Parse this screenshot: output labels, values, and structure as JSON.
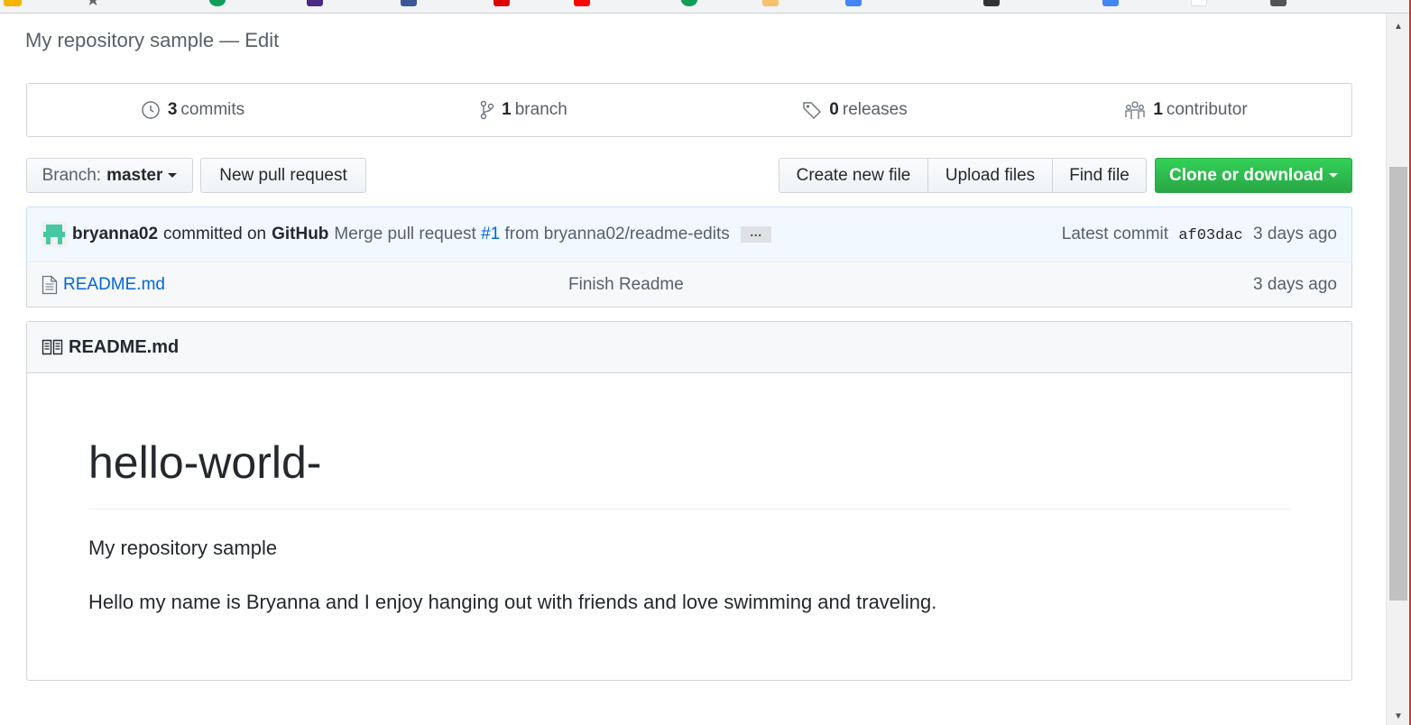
{
  "colors": {
    "link": "#0366d6",
    "clone_green": "#28a745",
    "tease_bg": "#f1f8ff"
  },
  "page": {
    "description": "My repository sample — Edit"
  },
  "summary": {
    "commits": {
      "count": "3",
      "label": "commits",
      "icon": "history-icon"
    },
    "branches": {
      "count": "1",
      "label": "branch",
      "icon": "git-branch-icon"
    },
    "releases": {
      "count": "0",
      "label": "releases",
      "icon": "tag-icon"
    },
    "contributors": {
      "count": "1",
      "label": "contributor",
      "icon": "organization-icon"
    }
  },
  "toolbar": {
    "branch_prefix": "Branch:",
    "branch_name": "master",
    "new_pull_request": "New pull request",
    "create_new_file": "Create new file",
    "upload_files": "Upload files",
    "find_file": "Find file",
    "clone_or_download": "Clone or download"
  },
  "commit": {
    "author": "bryanna02",
    "committed_on": "committed on",
    "committer": "GitHub",
    "message_start": "Merge pull request",
    "issue": "#1",
    "message_end": "from bryanna02/readme-edits",
    "ellipsis": "…",
    "latest_label": "Latest commit",
    "sha": "af03dac",
    "age": "3 days ago"
  },
  "files": [
    {
      "name": "README.md",
      "message": "Finish Readme",
      "age": "3 days ago",
      "icon": "file-icon"
    }
  ],
  "readme": {
    "header": "README.md",
    "title": "hello-world-",
    "paragraph1": "My repository sample",
    "paragraph2": "Hello my name is Bryanna and I enjoy hanging out with friends and love swimming and traveling."
  },
  "scrollbar": {
    "up": "▲",
    "down": "▼"
  }
}
